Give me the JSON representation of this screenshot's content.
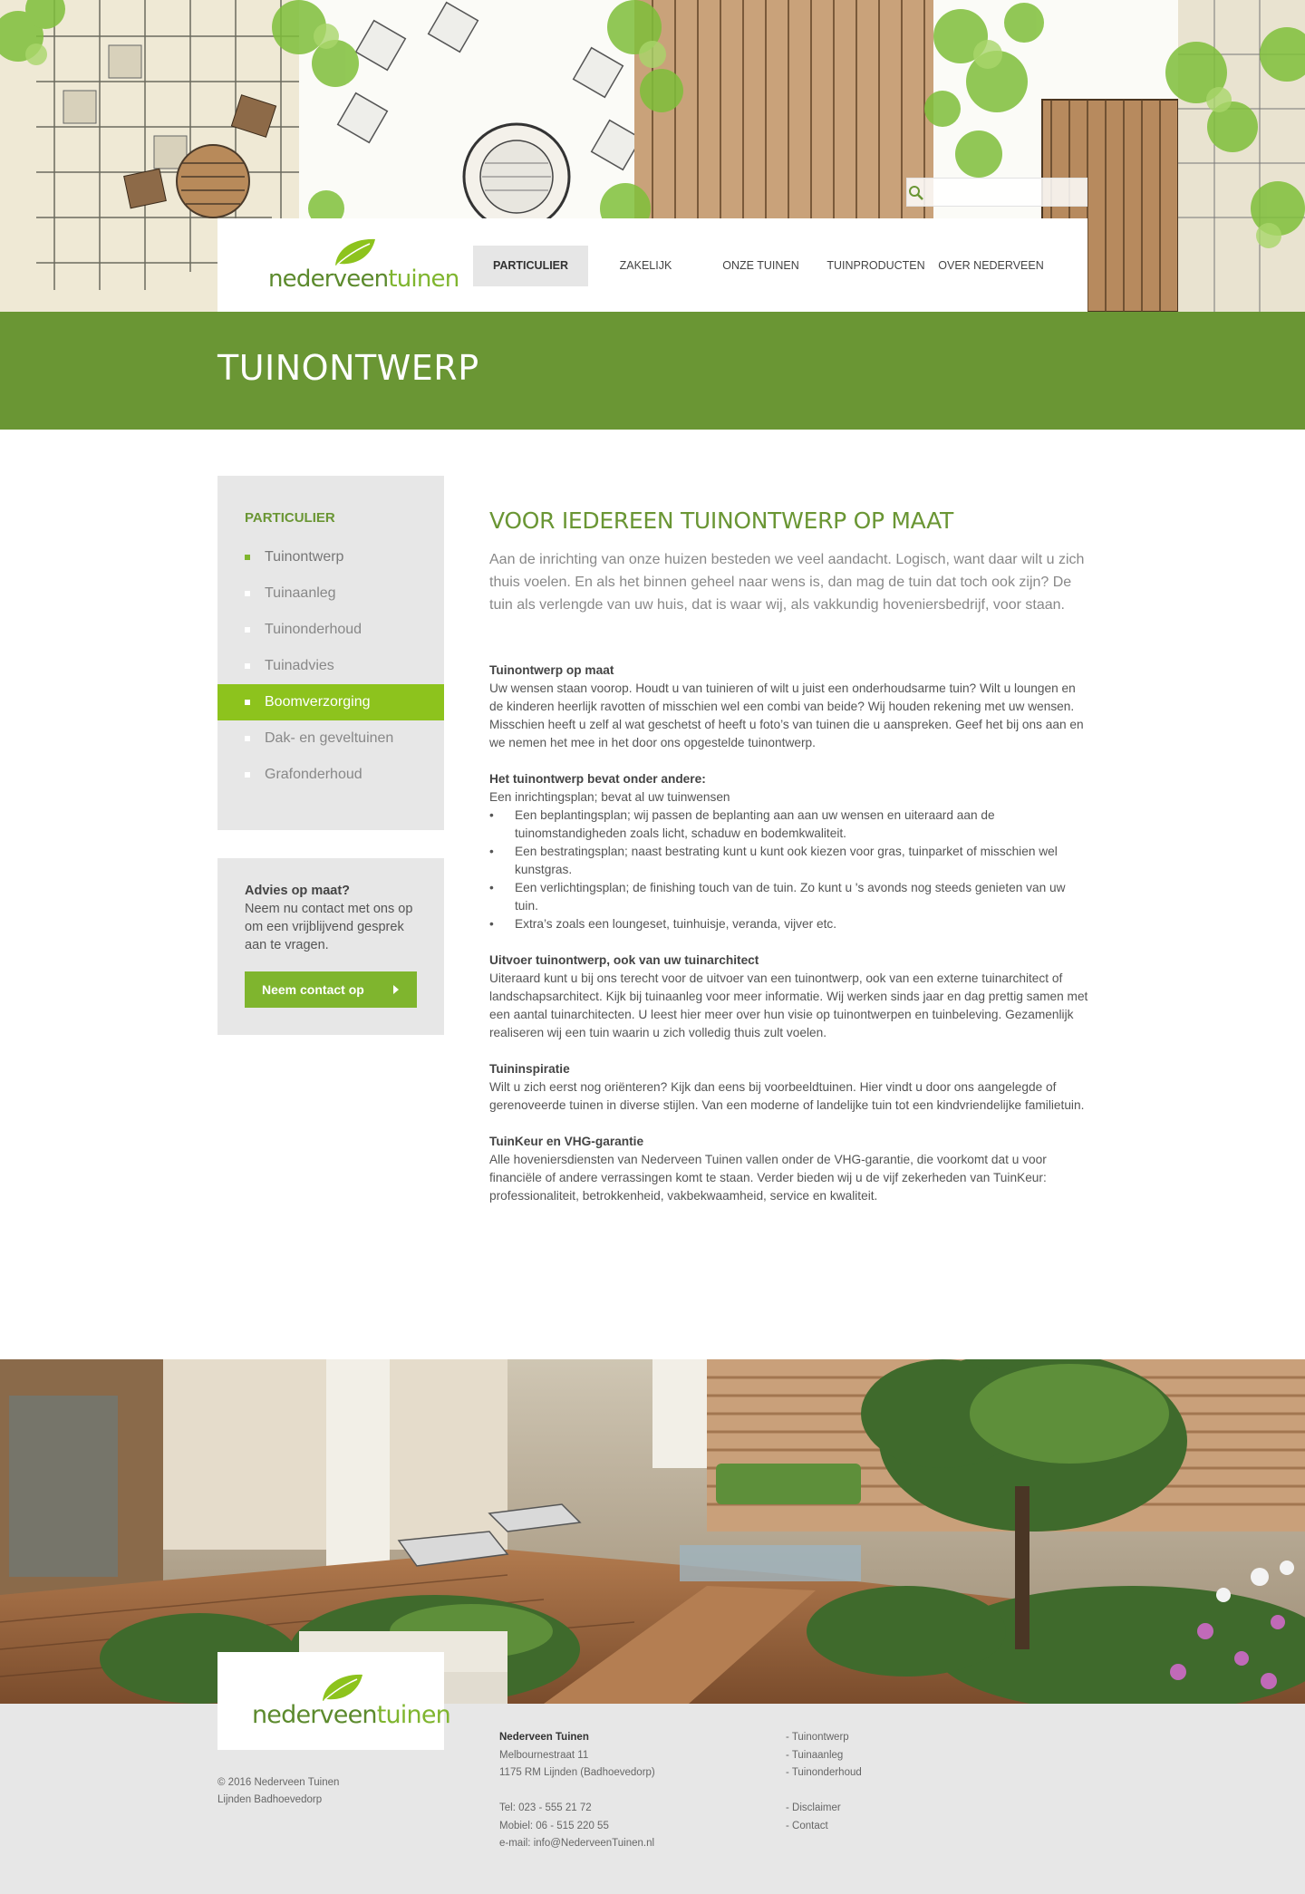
{
  "brand": {
    "logo_part1": "nederveen",
    "logo_part2": "tuinen",
    "green": "#6a9634",
    "lightgreen": "#8dc31d"
  },
  "search": {
    "placeholder": "",
    "icon": "search-icon"
  },
  "nav": {
    "items": [
      {
        "label": "PARTICULIER"
      },
      {
        "label": "ZAKELIJK"
      },
      {
        "label": "ONZE TUINEN"
      },
      {
        "label": "TUINPRODUCTEN"
      },
      {
        "label": "OVER NEDERVEEN"
      }
    ],
    "active_index": 0
  },
  "page": {
    "title": "TUINONTWERP"
  },
  "sidebar": {
    "heading": "PARTICULIER",
    "items": [
      {
        "label": "Tuinontwerp"
      },
      {
        "label": "Tuinaanleg"
      },
      {
        "label": "Tuinonderhoud"
      },
      {
        "label": "Tuinadvies"
      },
      {
        "label": "Boomverzorging"
      },
      {
        "label": "Dak- en geveltuinen"
      },
      {
        "label": "Grafonderhoud"
      }
    ]
  },
  "advies": {
    "title": "Advies op maat?",
    "text": "Neem nu contact met ons op om een vrijblijvend gesprek aan te vragen.",
    "button": "Neem contact op"
  },
  "content": {
    "heading": "VOOR IEDEREEN TUINONTWERP OP MAAT",
    "intro": "Aan de inrichting van onze huizen besteden we veel aandacht. Logisch, want daar wilt u zich thuis voelen. En als het binnen geheel naar wens is, dan mag de tuin dat toch ook zijn? De tuin als verlengde van uw huis, dat is waar wij, als vakkundig hoveniersbedrijf, voor staan.",
    "s1_title": "Tuinontwerp op maat",
    "s1_text": "Uw wensen staan voorop. Houdt u van tuinieren of wilt u juist een onderhoudsarme tuin? Wilt u loungen en de kinderen heerlijk ravotten of misschien wel een combi van beide? Wij houden rekening met uw wensen. Misschien heeft u zelf al wat geschetst of heeft u foto’s van tuinen die u aanspreken. Geef het bij ons aan en we nemen het mee in het door ons opgestelde tuinontwerp.",
    "s2_title": "Het tuinontwerp bevat onder andere:",
    "s2_lead": "Een inrichtingsplan; bevat al uw tuinwensen",
    "s2_items": [
      "Een beplantingsplan; wij passen de beplanting aan aan uw wensen en uiteraard aan de tuinomstandigheden zoals licht, schaduw en bodemkwaliteit.",
      "Een bestratingsplan; naast bestrating kunt u kunt ook kiezen voor gras, tuinparket of misschien wel kunstgras.",
      "Een verlichtingsplan; de finishing touch van de tuin. Zo kunt u 's avonds nog steeds genieten van uw tuin.",
      "Extra’s zoals een loungeset, tuinhuisje, veranda, vijver etc."
    ],
    "s3_title": "Uitvoer tuinontwerp, ook van uw tuinarchitect",
    "s3_text": "Uiteraard kunt u bij ons terecht voor de uitvoer van een tuinontwerp, ook van een externe tuinarchitect of landschapsarchitect. Kijk bij tuinaanleg voor meer informatie. Wij werken sinds jaar en dag prettig samen met een aantal tuinarchitecten. U leest hier meer over hun visie op tuinontwerpen en tuinbeleving. Gezamenlijk realiseren wij een tuin waarin u zich volledig thuis zult voelen.",
    "s4_title": "Tuininspiratie",
    "s4_text": "Wilt u zich eerst nog oriënteren? Kijk dan eens bij voorbeeldtuinen. Hier vindt u door ons aangelegde of gerenoveerde tuinen in diverse stijlen. Van een moderne of landelijke tuin tot een kindvriendelijke familietuin.",
    "s5_title": "TuinKeur en VHG-garantie",
    "s5_text": "Alle hoveniersdiensten van Nederveen Tuinen vallen onder de VHG-garantie, die voorkomt dat u voor financiële of andere verrassingen komt te staan. Verder bieden wij u de vijf zekerheden van TuinKeur: professionaliteit, betrokkenheid, vakbekwaamheid, service en kwaliteit."
  },
  "footer": {
    "copyright": "© 2016 Nederveen Tuinen",
    "location": "Lijnden Badhoevedorp",
    "company": "Nederveen Tuinen",
    "street": "Melbournestraat 11",
    "city": "1175 RM Lijnden (Badhoevedorp)",
    "tel": "Tel: 023 - 555 21 72",
    "mobile": "Mobiel: 06 - 515 220 55",
    "email": "e-mail: info@NederveenTuinen.nl",
    "links": [
      "- Tuinontwerp",
      "- Tuinaanleg",
      "- Tuinonderhoud",
      "- Disclaimer",
      "- Contact"
    ]
  }
}
